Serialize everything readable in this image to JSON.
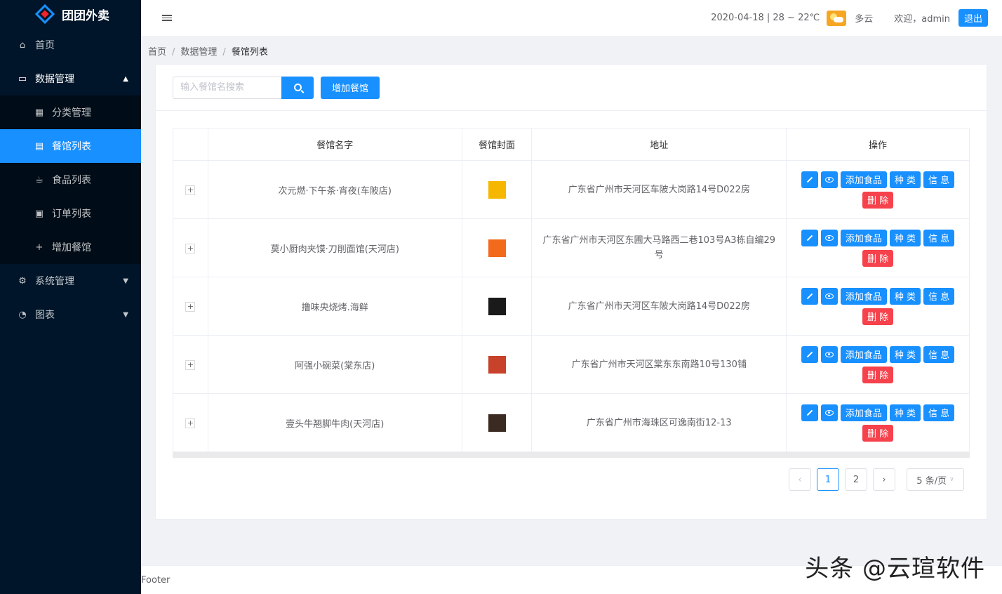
{
  "app": {
    "name": "团团外卖"
  },
  "sidebar": {
    "items": [
      {
        "label": "首页",
        "icon": "home-icon"
      },
      {
        "label": "数据管理",
        "icon": "laptop-icon",
        "expanded": true,
        "children": [
          {
            "label": "分类管理",
            "icon": "grid-icon"
          },
          {
            "label": "餐馆列表",
            "icon": "list-icon",
            "active": true
          },
          {
            "label": "食品列表",
            "icon": "cup-icon"
          },
          {
            "label": "订单列表",
            "icon": "order-icon"
          },
          {
            "label": "增加餐馆",
            "icon": "plus-icon"
          }
        ]
      },
      {
        "label": "系统管理",
        "icon": "gear-icon"
      },
      {
        "label": "图表",
        "icon": "pie-chart-icon"
      }
    ]
  },
  "header": {
    "date_weather": "2020-04-18 | 28 ~ 22℃",
    "weather": "多云",
    "welcome": "欢迎，admin",
    "logout": "退出"
  },
  "breadcrumb": [
    "首页",
    "数据管理",
    "餐馆列表"
  ],
  "toolbar": {
    "search_placeholder": "输入餐馆名搜索",
    "add_label": "增加餐馆"
  },
  "table": {
    "columns": [
      "餐馆名字",
      "餐馆封面",
      "地址",
      "操作"
    ],
    "rows": [
      {
        "name": "次元燃·下午茶·宵夜(车陂店)",
        "address": "广东省广州市天河区车陂大岗路14号D022房",
        "cover_color": "#f5b700"
      },
      {
        "name": "莫小厨肉夹馍·刀削面馆(天河店)",
        "address": "广东省广州市天河区东圃大马路西二巷103号A3栋自编29号",
        "cover_color": "#f26a1b"
      },
      {
        "name": "撸味央烧烤.海鲜",
        "address": "广东省广州市天河区车陂大岗路14号D022房",
        "cover_color": "#1a1a1a"
      },
      {
        "name": "阿强小碗菜(棠东店)",
        "address": "广东省广州市天河区棠东东南路10号130铺",
        "cover_color": "#c8412a"
      },
      {
        "name": "壹头牛翘脚牛肉(天河店)",
        "address": "广东省广州市海珠区可逸南街12-13",
        "cover_color": "#3b2a22"
      }
    ],
    "actions": {
      "add_food": "添加食品",
      "category": "种 类",
      "info": "信 息",
      "delete": "删 除"
    }
  },
  "pagination": {
    "pages": [
      "1",
      "2"
    ],
    "current": "1",
    "page_size": "5 条/页"
  },
  "footer": {
    "text": "Footer"
  },
  "watermark": "头条 @云瑄软件"
}
